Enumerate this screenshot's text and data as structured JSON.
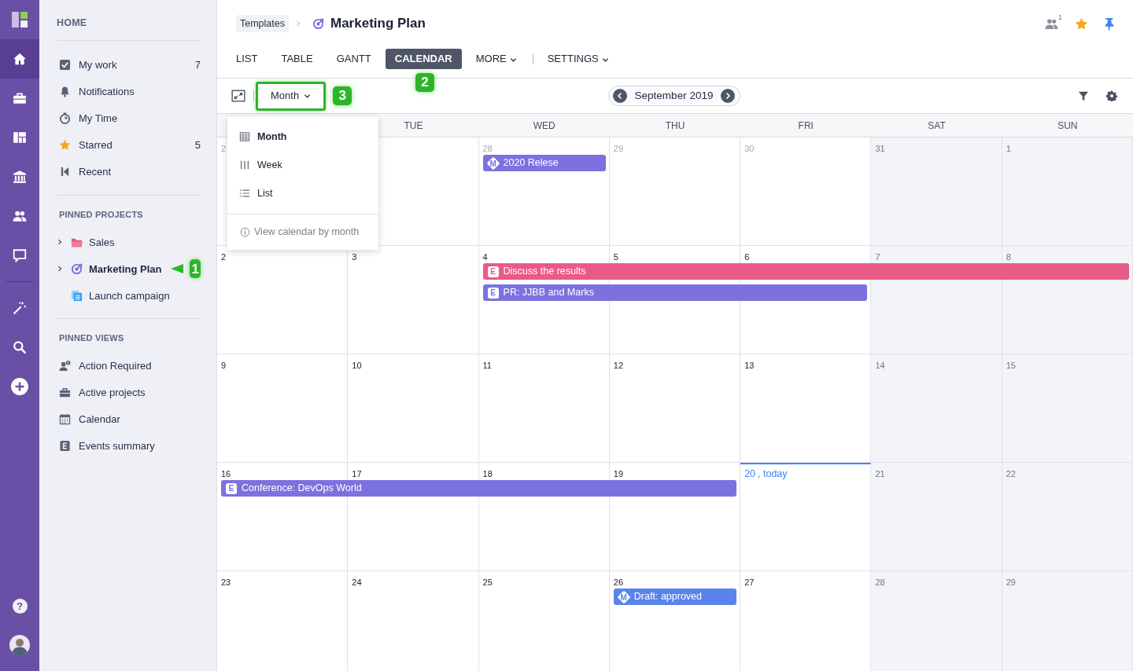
{
  "rail": {
    "items": [
      {
        "selected": true
      },
      {
        "selected": false
      },
      {
        "selected": false
      },
      {
        "selected": false
      },
      {
        "selected": false
      },
      {
        "selected": false
      }
    ],
    "tools": [
      {
        "selected": false
      },
      {
        "selected": false
      },
      {
        "selected": false
      }
    ],
    "help": "?"
  },
  "sidebar": {
    "sections": [
      {
        "title": "HOME",
        "items": [
          {
            "label": "My work",
            "count": "7"
          },
          {
            "label": "Notifications"
          },
          {
            "label": "My Time"
          },
          {
            "label": "Starred",
            "count": "5"
          },
          {
            "label": "Recent"
          }
        ]
      },
      {
        "title": "PINNED PROJECTS",
        "items": [
          {
            "label": "Sales",
            "expandable": true,
            "selected": false
          },
          {
            "label": "Marketing Plan",
            "expandable": true,
            "selected": true,
            "callout": "1"
          },
          {
            "label": "Launch campaign",
            "expandable": false,
            "selected": false
          }
        ]
      },
      {
        "title": "PINNED VIEWS",
        "items": [
          {
            "label": "Action Required"
          },
          {
            "label": "Active projects"
          },
          {
            "label": "Calendar"
          },
          {
            "label": "Events summary"
          }
        ]
      }
    ]
  },
  "header": {
    "breadcrumb": "Templates",
    "title": "Marketing Plan",
    "watchers": "1",
    "starred": true,
    "pinned": true
  },
  "tabs": [
    {
      "label": "LIST",
      "selected": false,
      "kind": "tab"
    },
    {
      "label": "TABLE",
      "selected": false,
      "kind": "tab"
    },
    {
      "label": "GANTT",
      "selected": false,
      "kind": "tab"
    },
    {
      "label": "CALENDAR",
      "selected": true,
      "kind": "tab",
      "callout": "2"
    },
    {
      "label": "MORE",
      "selected": false,
      "kind": "menu"
    },
    {
      "label": "SETTINGS",
      "selected": false,
      "kind": "menu",
      "separator_before": true
    }
  ],
  "toolbar": {
    "view_button": {
      "label": "Month",
      "highlighted": true,
      "open": true,
      "callout": "3"
    },
    "period": "September 2019"
  },
  "view_menu": {
    "items": [
      {
        "label": "Month",
        "selected": true
      },
      {
        "label": "Week",
        "selected": false
      },
      {
        "label": "List",
        "selected": false
      }
    ],
    "hint": "View calendar by month"
  },
  "calendar": {
    "day_headers": [
      "TUE",
      "WED",
      "THU",
      "FRI",
      "SAT",
      "SUN"
    ],
    "weeks": [
      {
        "days": [
          {
            "num": "2",
            "outside": true,
            "weekend": false
          },
          {
            "weekend": false
          },
          {
            "num": "28",
            "outside": true,
            "weekend": false,
            "events": [
              {
                "title": "2020 Relese",
                "badge": "M",
                "kind": "milestone",
                "color": "#7b72e0"
              }
            ]
          },
          {
            "num": "29",
            "outside": true,
            "weekend": false
          },
          {
            "num": "30",
            "outside": true,
            "weekend": false
          },
          {
            "num": "31",
            "outside": false,
            "weekend": true
          },
          {
            "num": "1",
            "outside": false,
            "weekend": true
          }
        ]
      },
      {
        "days": [
          {
            "num": "2",
            "weekend": false
          },
          {
            "num": "3",
            "weekend": false
          },
          {
            "num": "4",
            "weekend": false,
            "events": [
              {
                "title": "Discuss the results",
                "badge": "E",
                "kind": "event",
                "color": "#e95b86"
              },
              {
                "title": "PR: JJBB and Marks",
                "badge": "E",
                "kind": "event",
                "color": "#7b72e0"
              }
            ]
          },
          {
            "num": "5",
            "weekend": false,
            "events": [
              {
                "kind": "continuation"
              },
              {
                "kind": "continuation"
              }
            ]
          },
          {
            "num": "6",
            "weekend": false,
            "events": [
              {
                "kind": "continuation"
              },
              {
                "kind": "continuation"
              }
            ]
          },
          {
            "num": "7",
            "weekend": true,
            "events": [
              {
                "kind": "continuation"
              }
            ]
          },
          {
            "num": "8",
            "weekend": true,
            "events": [
              {
                "kind": "continuation"
              }
            ]
          }
        ]
      },
      {
        "days": [
          {
            "num": "9",
            "weekend": false
          },
          {
            "num": "10",
            "weekend": false
          },
          {
            "num": "11",
            "weekend": false
          },
          {
            "num": "12",
            "weekend": false
          },
          {
            "num": "13",
            "weekend": false
          },
          {
            "num": "14",
            "weekend": true
          },
          {
            "num": "15",
            "weekend": true
          }
        ]
      },
      {
        "days": [
          {
            "num": "16",
            "weekend": false,
            "events": [
              {
                "title": "Conference: DevOps World",
                "badge": "E",
                "kind": "event",
                "color": "#7b72e0"
              }
            ]
          },
          {
            "num": "17",
            "weekend": false,
            "events": [
              {
                "kind": "continuation"
              }
            ]
          },
          {
            "num": "18",
            "weekend": false,
            "events": [
              {
                "kind": "continuation"
              }
            ]
          },
          {
            "num": "19",
            "weekend": false,
            "events": [
              {
                "kind": "continuation"
              }
            ]
          },
          {
            "num": "20",
            "note": ", today",
            "today": true,
            "weekend": false
          },
          {
            "num": "21",
            "weekend": true
          },
          {
            "num": "22",
            "weekend": true
          }
        ]
      },
      {
        "days": [
          {
            "num": "23",
            "weekend": false
          },
          {
            "num": "24",
            "weekend": false
          },
          {
            "num": "25",
            "weekend": false
          },
          {
            "num": "26",
            "weekend": false,
            "events": [
              {
                "title": "Draft: approved",
                "badge": "M",
                "kind": "milestone",
                "color": "#5a84ec"
              }
            ]
          },
          {
            "num": "27",
            "weekend": false
          },
          {
            "num": "28",
            "weekend": true
          },
          {
            "num": "29",
            "weekend": true
          }
        ]
      }
    ]
  }
}
